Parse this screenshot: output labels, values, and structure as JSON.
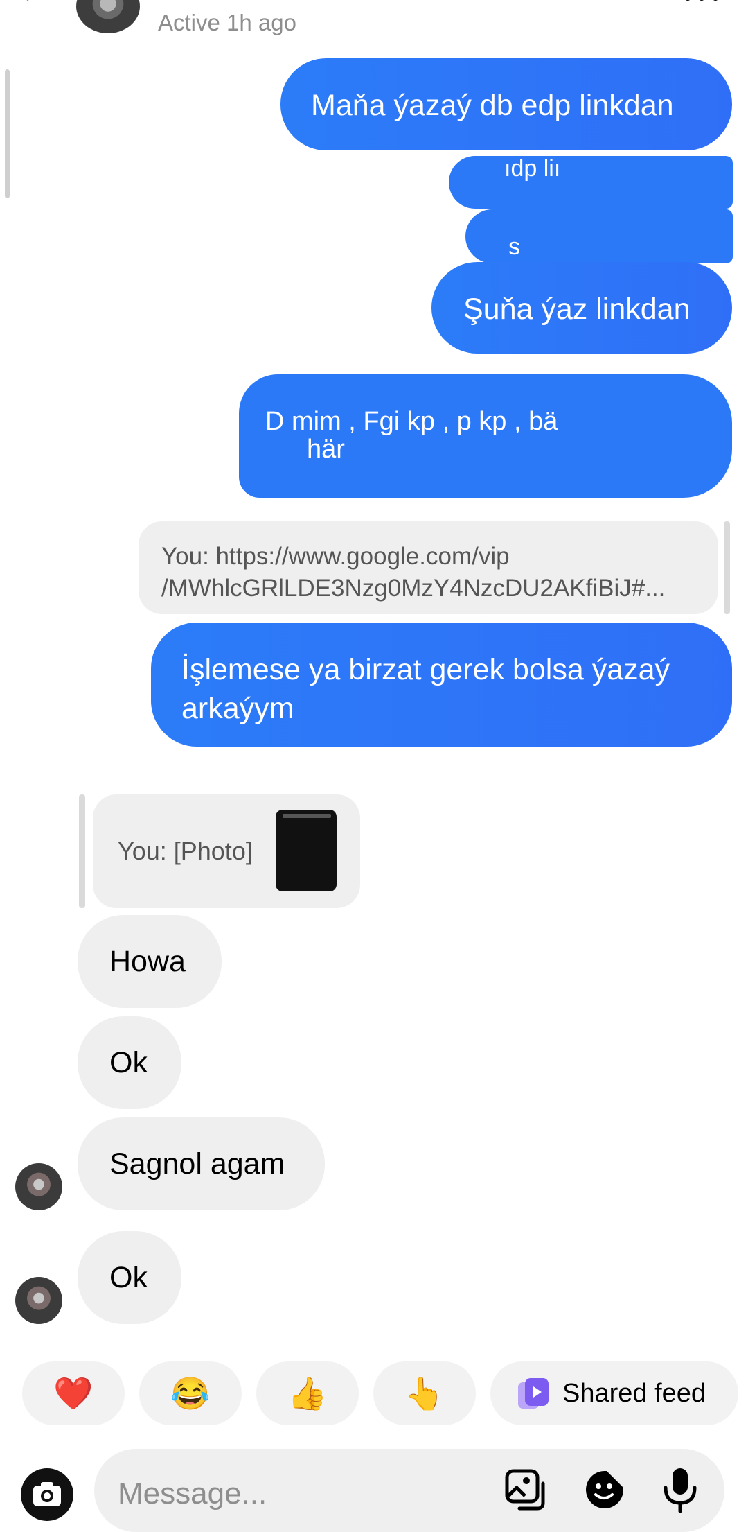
{
  "header": {
    "status": "Active 1h ago",
    "icons": {
      "back": "back-arrow-icon",
      "more": "more-dots-icon"
    }
  },
  "messages": {
    "outgoing_1": "Maňa ýazaý db edp linkdan",
    "glitch_1": "ıdp liı",
    "glitch_2": "s",
    "outgoing_3": "Şuňa ýaz linkdan",
    "glitch_3_line1": "D mim , Fgi kp  , p kp , bä",
    "glitch_3_line2": "här",
    "link_preview": {
      "line1": "You: https://www.google.com/vip",
      "line2": "/MWhlcGRlLDE3Nzg0MzY4NzcDU2AKfiBiJ#..."
    },
    "outgoing_5": "İşlemese ya birzat gerek bolsa ýazaý arkaýym",
    "photo_reply": "You: [Photo]",
    "incoming_1": "Howa",
    "incoming_2": "Ok",
    "incoming_3": "Sagnol agam",
    "incoming_4": "Ok"
  },
  "quick_reactions": {
    "heart": "❤️",
    "laugh": "😂",
    "thumbs_up": "👍",
    "point": "👆",
    "shared_feed": "Shared feed"
  },
  "composer": {
    "placeholder": "Message...",
    "icons": {
      "camera": "camera-icon",
      "gallery": "gallery-icon",
      "sticker": "sticker-icon",
      "mic": "microphone-icon"
    }
  },
  "colors": {
    "outgoing_bubble": "#2f74f7",
    "incoming_bubble": "#efefef",
    "muted_text": "#8e8e8e"
  }
}
